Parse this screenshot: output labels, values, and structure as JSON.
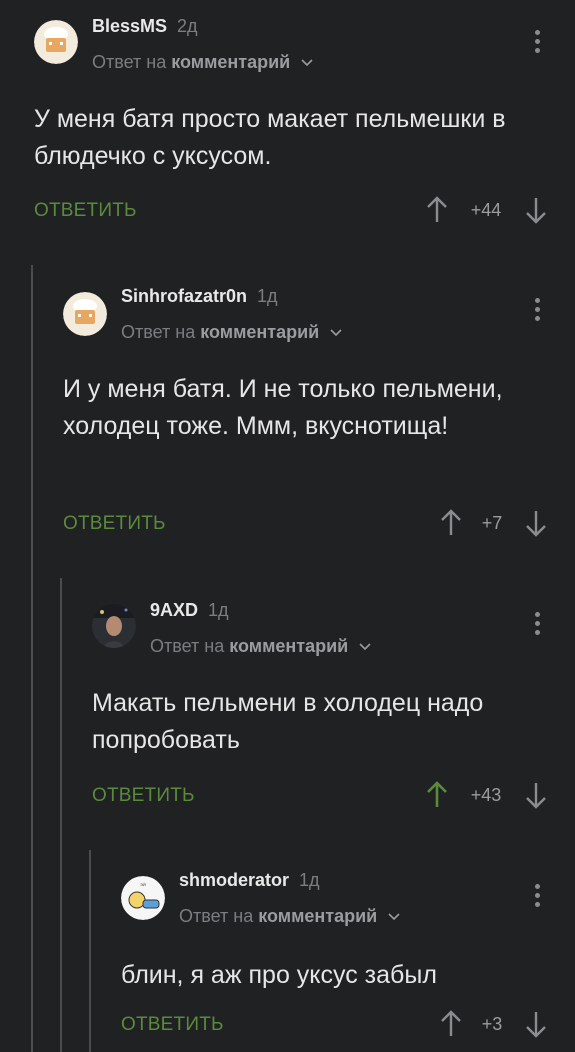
{
  "comments": [
    {
      "username": "BlessMS",
      "time": "2д",
      "reply_prefix": "Ответ на",
      "reply_target": "комментарий",
      "text": "У меня батя просто макает пельмешки в блюдечко с уксусом.",
      "reply_label": "ОТВЕТИТЬ",
      "rating": "+44",
      "upvoted": false
    },
    {
      "username": "Sinhrofazatr0n",
      "time": "1д",
      "reply_prefix": "Ответ на",
      "reply_target": "комментарий",
      "text": "И у меня батя. И не только пельмени, холодец тоже. Ммм, вкуснотища!",
      "reply_label": "ОТВЕТИТЬ",
      "rating": "+7",
      "upvoted": false
    },
    {
      "username": "9AXD",
      "time": "1д",
      "reply_prefix": "Ответ на",
      "reply_target": "комментарий",
      "text": "Макать пельмени в холодец надо попробовать",
      "reply_label": "ОТВЕТИТЬ",
      "rating": "+43",
      "upvoted": true
    },
    {
      "username": "shmoderator",
      "time": "1д",
      "reply_prefix": "Ответ на",
      "reply_target": "комментарий",
      "text": "блин, я аж про уксус забыл",
      "reply_label": "ОТВЕТИТЬ",
      "rating": "+3",
      "upvoted": false
    }
  ],
  "colors": {
    "background": "#1f2123",
    "accent_green": "#5a8a3c",
    "muted_text": "#7b7d80",
    "thread_line": "#4a4c4e"
  }
}
